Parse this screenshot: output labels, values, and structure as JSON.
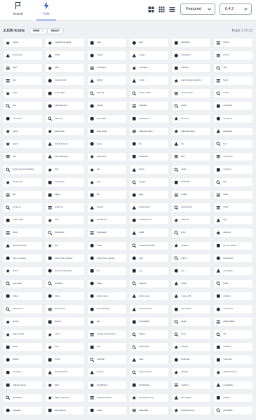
{
  "tabs": [
    {
      "label": "Brands",
      "icon": "flag-icon",
      "active": false
    },
    {
      "label": "Free",
      "icon": "bolt-icon",
      "active": true
    }
  ],
  "view": {
    "buttons": [
      "grid-large-icon",
      "grid-small-icon",
      "list-icon"
    ]
  },
  "sort": {
    "value": "Featured"
  },
  "version": {
    "value": "6.4.2"
  },
  "results": {
    "count": "2,035 Icons",
    "chips": [
      {
        "label": "FREE",
        "removable": true
      },
      {
        "label": "RESET",
        "removable": false
      }
    ],
    "page": "Page 1 of 13"
  },
  "icons": [
    "house",
    "magnifying-glass",
    "user",
    "user",
    "facebook",
    "check",
    "download",
    "twitter",
    "image",
    "image",
    "instagram",
    "phone",
    "bars",
    "bars",
    "envelope",
    "envelope",
    "linkedin",
    "star",
    "star",
    "location-dot",
    "github",
    "music",
    "wand-magic-sparkles",
    "heart",
    "heart",
    "arrow-right",
    "discord",
    "circle-xmark",
    "circle-xmark",
    "bomb",
    "poo",
    "camera-retro",
    "xmark",
    "youtube",
    "cloud",
    "comment",
    "comment",
    "caret-up",
    "truck-fast",
    "wordpress",
    "pen-nib",
    "arrow-up",
    "hippo",
    "face-smile",
    "face-smile",
    "calendar-days",
    "calendar-days",
    "paperclip",
    "apple",
    "shield-halved",
    "figma",
    "file",
    "file",
    "bell",
    "bell",
    "cart-shopping",
    "clipboard",
    "clipboard",
    "filter",
    "circle-info",
    "arrow-up-from-bracket",
    "bolt",
    "car",
    "ghost",
    "apple",
    "mug-hot",
    "circle-user",
    "circle-user",
    "pen",
    "google",
    "umbrella",
    "gift",
    "film",
    "hippo",
    "list",
    "gear",
    "reddit",
    "trash",
    "circle-up",
    "circle-up",
    "docker",
    "circle-down",
    "circle-down",
    "inbox",
    "rotate-right",
    "lock",
    "wordpress",
    "headphones",
    "barcode",
    "tag",
    "book",
    "bookmark",
    "bookmark",
    "slack",
    "print",
    "camera",
    "stack-overflow",
    "font",
    "video",
    "circle-half-stroke",
    "dropbox",
    "pen-to-square",
    "pen-to-square",
    "share-from-square",
    "share-from-square",
    "plus",
    "minus",
    "backward",
    "share",
    "circle-exclamation",
    "fire",
    "eye",
    "eye",
    "eye-slash",
    "eye-slash",
    "dribbble",
    "plane",
    "magnet",
    "hand",
    "hand",
    "folder",
    "folder",
    "folder-open",
    "folder-open",
    "money-bill",
    "dropbox",
    "thumbs-up",
    "thumbs-up",
    "thumbs-down",
    "thumbs-down",
    "comments",
    "comments",
    "lemon",
    "lemon",
    "key",
    "thumbtack",
    "gears",
    "paper-plane",
    "paper-plane",
    "code",
    "square-poll-vertical",
    "github",
    "truck",
    "city",
    "ticket",
    "tree",
    "wifi",
    "paint-roller",
    "bicycle",
    "android",
    "sliders",
    "brush",
    "hashtag",
    "flask",
    "briefcase",
    "compass",
    "compass",
    "dumpster-fire",
    "person",
    "person-dress",
    "shopify",
    "address-book",
    "address-book",
    "bath",
    "handshake",
    "handshake",
    "medium",
    "snowflake",
    "snowflake",
    "right-to-bracket",
    "earth-americas",
    "cloud-arrow-up",
    "binoculars",
    "palette",
    "codepen",
    "layer-group",
    "users",
    "gamepad",
    "business-time",
    "cloudflare"
  ]
}
